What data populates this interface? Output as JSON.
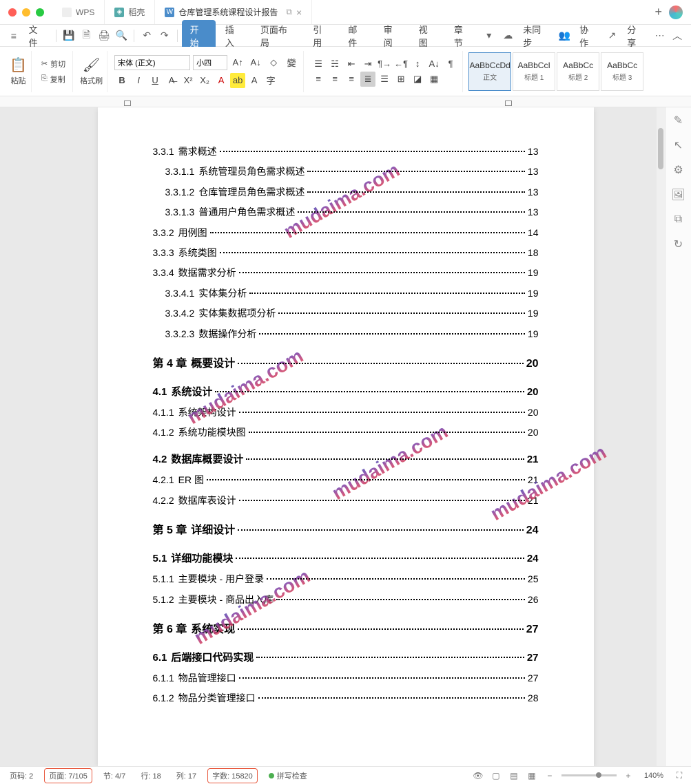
{
  "titlebar": {
    "tabs": [
      {
        "label": "WPS",
        "icon": ""
      },
      {
        "label": "稻壳",
        "icon": "◈"
      },
      {
        "label": "仓库管理系统课程设计报告",
        "icon": "W",
        "active": true
      }
    ]
  },
  "menubar": {
    "file": "文件",
    "tabs": [
      "开始",
      "插入",
      "页面布局",
      "引用",
      "邮件",
      "审阅",
      "视图",
      "章节"
    ],
    "active_tab": "开始",
    "sync": "未同步",
    "collab": "协作",
    "share": "分享"
  },
  "ribbon": {
    "paste": "粘贴",
    "cut": "剪切",
    "copy": "复制",
    "format_painter": "格式刷",
    "font_family": "宋体 (正文)",
    "font_size": "小四",
    "styles": [
      {
        "preview": "AaBbCcDd",
        "label": "正文",
        "active": true
      },
      {
        "preview": "AaBbCcI",
        "label": "标题 1"
      },
      {
        "preview": "AaBbCc",
        "label": "标题 2"
      },
      {
        "preview": "AaBbCc",
        "label": "标题 3"
      }
    ]
  },
  "toc": [
    {
      "num": "3.3.1",
      "title": "需求概述",
      "page": "13",
      "level": 1
    },
    {
      "num": "3.3.1.1",
      "title": "系统管理员角色需求概述",
      "page": "13",
      "level": 2
    },
    {
      "num": "3.3.1.2",
      "title": "仓库管理员角色需求概述",
      "page": "13",
      "level": 2
    },
    {
      "num": "3.3.1.3",
      "title": "普通用户角色需求概述",
      "page": "13",
      "level": 2
    },
    {
      "num": "3.3.2",
      "title": "用例图",
      "page": "14",
      "level": 1
    },
    {
      "num": "3.3.3",
      "title": "系统类图",
      "page": "18",
      "level": 1
    },
    {
      "num": "3.3.4",
      "title": "数据需求分析",
      "page": "19",
      "level": 1
    },
    {
      "num": "3.3.4.1",
      "title": "实体集分析",
      "page": "19",
      "level": 2
    },
    {
      "num": "3.3.4.2",
      "title": "实体集数据项分析",
      "page": "19",
      "level": 2
    },
    {
      "num": "3.3.2.3",
      "title": "数据操作分析",
      "page": "19",
      "level": 2
    },
    {
      "num": "第 4 章",
      "title": "概要设计",
      "page": "20",
      "level": "chapter"
    },
    {
      "num": "4.1",
      "title": "系统设计",
      "page": "20",
      "level": "section"
    },
    {
      "num": "4.1.1",
      "title": "系统架构设计",
      "page": "20",
      "level": 1
    },
    {
      "num": "4.1.2",
      "title": "系统功能模块图",
      "page": "20",
      "level": 1
    },
    {
      "num": "4.2",
      "title": "数据库概要设计",
      "page": "21",
      "level": "section"
    },
    {
      "num": "4.2.1",
      "title": "ER 图",
      "page": "21",
      "level": 1
    },
    {
      "num": "4.2.2",
      "title": "数据库表设计",
      "page": "21",
      "level": 1
    },
    {
      "num": "第 5 章",
      "title": "详细设计",
      "page": "24",
      "level": "chapter"
    },
    {
      "num": "5.1",
      "title": "详细功能模块",
      "page": "24",
      "level": "section"
    },
    {
      "num": "5.1.1",
      "title": "主要模块 - 用户登录",
      "page": "25",
      "level": 1
    },
    {
      "num": "5.1.2",
      "title": "主要模块 - 商品出入库",
      "page": "26",
      "level": 1
    },
    {
      "num": "第 6 章",
      "title": "系统实现",
      "page": "27",
      "level": "chapter"
    },
    {
      "num": "6.1",
      "title": "后端接口代码实现",
      "page": "27",
      "level": "section"
    },
    {
      "num": "6.1.1",
      "title": "物品管理接口",
      "page": "27",
      "level": 1
    },
    {
      "num": "6.1.2",
      "title": "物品分类管理接口",
      "page": "28",
      "level": 1
    }
  ],
  "watermark": "mudaima.com",
  "statusbar": {
    "page_num_label": "页码:",
    "page_num": "2",
    "page_label": "页面:",
    "page": "7/105",
    "section_label": "节:",
    "section": "4/7",
    "line_label": "行:",
    "line": "18",
    "col_label": "列:",
    "col": "17",
    "words_label": "字数:",
    "words": "15820",
    "spell": "拼写检查",
    "zoom": "140%"
  }
}
